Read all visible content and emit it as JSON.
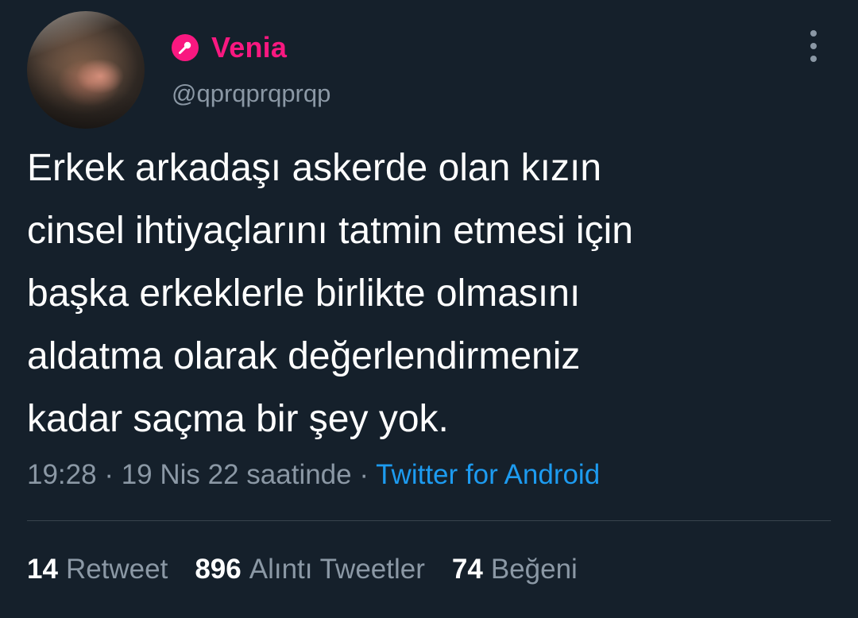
{
  "user": {
    "display_name": "Venia",
    "handle": "@qprqprqprqp",
    "name_icon": "microphone-icon",
    "name_color": "#f91880"
  },
  "tweet": {
    "lines": [
      "Erkek arkadaşı askerde olan kızın",
      "cinsel ihtiyaçlarını tatmin etmesi için",
      "başka erkeklerle birlikte olmasını",
      "aldatma olarak değerlendirmeniz",
      "kadar saçma bir şey yok."
    ]
  },
  "meta": {
    "time": "19:28",
    "separator": " · ",
    "date": "19 Nis 22 saatinde",
    "source": "Twitter for Android",
    "source_color": "#1d9bf0"
  },
  "stats": {
    "retweets": {
      "count": "14",
      "label": "Retweet"
    },
    "quotes": {
      "count": "896",
      "label": "Alıntı Tweetler"
    },
    "likes": {
      "count": "74",
      "label": "Beğeni"
    }
  },
  "colors": {
    "background": "#15202b",
    "secondary_text": "#8b98a5",
    "divider": "#38444d"
  },
  "icons": {
    "more": "more-vertical-icon"
  }
}
